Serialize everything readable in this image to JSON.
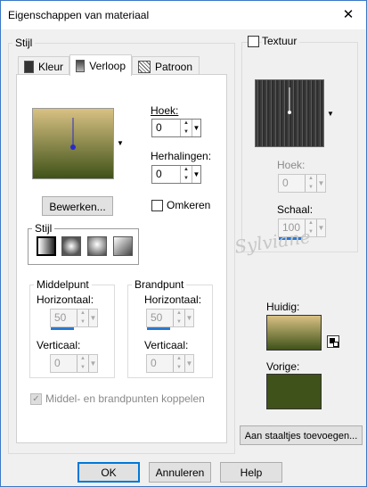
{
  "window": {
    "title": "Eigenschappen van materiaal",
    "close_glyph": "✕"
  },
  "stijl_group": {
    "legend": "Stijl"
  },
  "tabs": [
    {
      "label": "Kleur"
    },
    {
      "label": "Verloop"
    },
    {
      "label": "Patroon"
    }
  ],
  "gradient": {
    "color_top": "#d9c183",
    "color_bottom": "#3f5219",
    "marker_color": "#2a2acc"
  },
  "hoek": {
    "label": "Hoek:",
    "value": "0"
  },
  "herhalingen": {
    "label": "Herhalingen:",
    "value": "0"
  },
  "bewerken_button": "Bewerken...",
  "omkeren": {
    "label": "Omkeren",
    "checked": false
  },
  "stijl_box": {
    "legend": "Stijl",
    "styles": [
      "linear",
      "rectangular",
      "sunburst",
      "radial"
    ]
  },
  "middelpunt": {
    "legend": "Middelpunt",
    "horizontaal_label": "Horizontaal:",
    "horizontaal_value": "50",
    "horizontaal_fraction": 0.5,
    "verticaal_label": "Verticaal:",
    "verticaal_value": "0"
  },
  "brandpunt": {
    "legend": "Brandpunt",
    "horizontaal_label": "Horizontaal:",
    "horizontaal_value": "50",
    "horizontaal_fraction": 0.5,
    "verticaal_label": "Verticaal:",
    "verticaal_value": "0"
  },
  "koppelen": {
    "label": "Middel- en brandpunten koppelen",
    "checked": true
  },
  "textuur": {
    "label": "Textuur",
    "checked": false,
    "hoek_label": "Hoek:",
    "hoek_value": "0",
    "schaal_label": "Schaal:",
    "schaal_value": "100"
  },
  "huidig": {
    "label": "Huidig:"
  },
  "vorige": {
    "label": "Vorige:",
    "color": "#3f5219"
  },
  "watermark": "Sylviane",
  "add_swatches_button": "Aan staaltjes toevoegen...",
  "footer": {
    "ok": "OK",
    "annuleren": "Annuleren",
    "help": "Help"
  }
}
